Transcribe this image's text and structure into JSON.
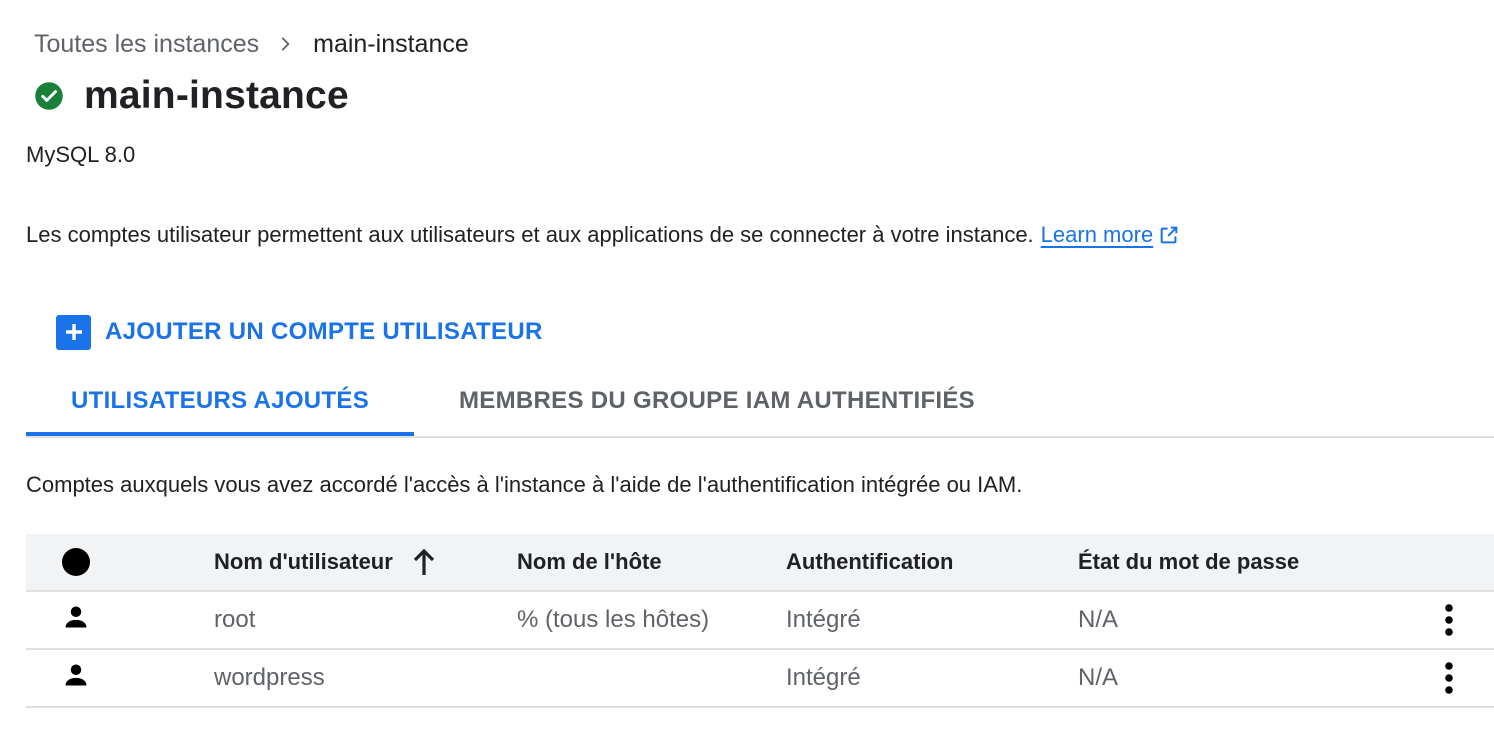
{
  "breadcrumb": {
    "parent": "Toutes les instances",
    "current": "main-instance"
  },
  "header": {
    "title": "main-instance",
    "status_icon": "check-circle-icon",
    "status_color": "#188038"
  },
  "instance": {
    "version": "MySQL 8.0"
  },
  "description": {
    "text": "Les comptes utilisateur permettent aux utilisateurs et aux applications de se connecter à votre instance.",
    "link": "Learn more"
  },
  "actions": {
    "add_user": "AJOUTER UN COMPTE UTILISATEUR"
  },
  "tabs": [
    {
      "label": "UTILISATEURS AJOUTÉS",
      "active": true
    },
    {
      "label": "MEMBRES DU GROUPE IAM AUTHENTIFIÉS",
      "active": false
    }
  ],
  "tab_description": "Comptes auxquels vous avez accordé l'accès à l'instance à l'aide de l'authentification intégrée ou IAM.",
  "table": {
    "columns": [
      "Nom d'utilisateur",
      "Nom de l'hôte",
      "Authentification",
      "État du mot de passe"
    ],
    "sort": {
      "column": "Nom d'utilisateur",
      "direction": "ascending"
    },
    "rows": [
      {
        "user": "root",
        "host": "% (tous les hôtes)",
        "auth": "Intégré",
        "password_status": "N/A"
      },
      {
        "user": "wordpress",
        "host": "",
        "auth": "Intégré",
        "password_status": "N/A"
      }
    ]
  },
  "colors": {
    "accent": "#1a73e8",
    "text": "#202124",
    "muted": "#5f6368"
  }
}
